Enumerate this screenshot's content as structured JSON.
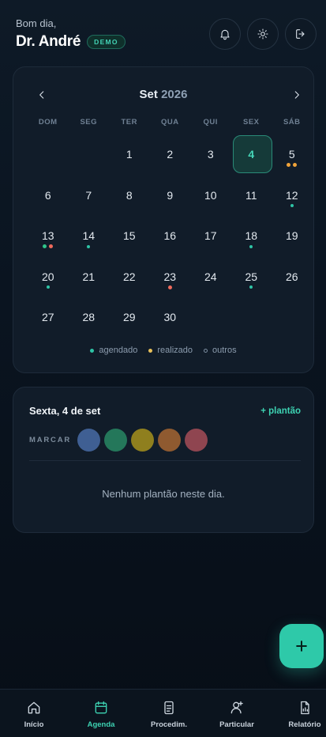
{
  "header": {
    "greeting": "Bom dia,",
    "user_name": "Dr. André",
    "badge": "DEMO",
    "buttons": [
      {
        "icon": "bell-icon"
      },
      {
        "icon": "sun-icon"
      },
      {
        "icon": "logout-icon"
      }
    ]
  },
  "calendar": {
    "month": "Set",
    "year": "2026",
    "weekdays": [
      "DOM",
      "SEG",
      "TER",
      "QUA",
      "QUI",
      "SEX",
      "SÁB"
    ],
    "leading_blanks": 2,
    "days": [
      {
        "day": "1",
        "dots": []
      },
      {
        "day": "2",
        "dots": []
      },
      {
        "day": "3",
        "dots": []
      },
      {
        "day": "4",
        "dots": [],
        "selected": true
      },
      {
        "day": "5",
        "dots": [
          "orange",
          "orange"
        ]
      },
      {
        "day": "6",
        "dots": []
      },
      {
        "day": "7",
        "dots": []
      },
      {
        "day": "8",
        "dots": []
      },
      {
        "day": "9",
        "dots": []
      },
      {
        "day": "10",
        "dots": []
      },
      {
        "day": "11",
        "dots": []
      },
      {
        "day": "12",
        "dots": [
          "teal"
        ]
      },
      {
        "day": "13",
        "dots": [
          "green",
          "red"
        ]
      },
      {
        "day": "14",
        "dots": [
          "teal"
        ]
      },
      {
        "day": "15",
        "dots": []
      },
      {
        "day": "16",
        "dots": []
      },
      {
        "day": "17",
        "dots": []
      },
      {
        "day": "18",
        "dots": [
          "teal"
        ]
      },
      {
        "day": "19",
        "dots": []
      },
      {
        "day": "20",
        "dots": [
          "teal"
        ]
      },
      {
        "day": "21",
        "dots": []
      },
      {
        "day": "22",
        "dots": []
      },
      {
        "day": "23",
        "dots": [
          "red"
        ]
      },
      {
        "day": "24",
        "dots": []
      },
      {
        "day": "25",
        "dots": [
          "teal"
        ]
      },
      {
        "day": "26",
        "dots": []
      },
      {
        "day": "27",
        "dots": []
      },
      {
        "day": "28",
        "dots": []
      },
      {
        "day": "29",
        "dots": []
      },
      {
        "day": "30",
        "dots": []
      }
    ],
    "legend": {
      "agendado": "agendado",
      "realizado": "realizado",
      "outros": "outros"
    }
  },
  "day_panel": {
    "title": "Sexta, 4 de set",
    "add_label": "+ plantão",
    "marcar_label": "MARCAR",
    "colors": [
      "#3f5f93",
      "#24775a",
      "#8f7f1e",
      "#8f5a30",
      "#8f4550"
    ],
    "empty_message": "Nenhum plantão neste dia."
  },
  "colors": {
    "accent": "#2ec9a9",
    "dot_teal": "#2ec4a6",
    "dot_green": "#30c489",
    "dot_red": "#ef6a5c",
    "dot_orange": "#f0a33a"
  },
  "bottom_nav": [
    {
      "label": "Início",
      "icon": "home-icon"
    },
    {
      "label": "Agenda",
      "icon": "calendar-icon",
      "active": true
    },
    {
      "label": "Procedim.",
      "icon": "document-icon"
    },
    {
      "label": "Particular",
      "icon": "user-add-icon"
    },
    {
      "label": "Relatório",
      "icon": "report-icon"
    }
  ]
}
